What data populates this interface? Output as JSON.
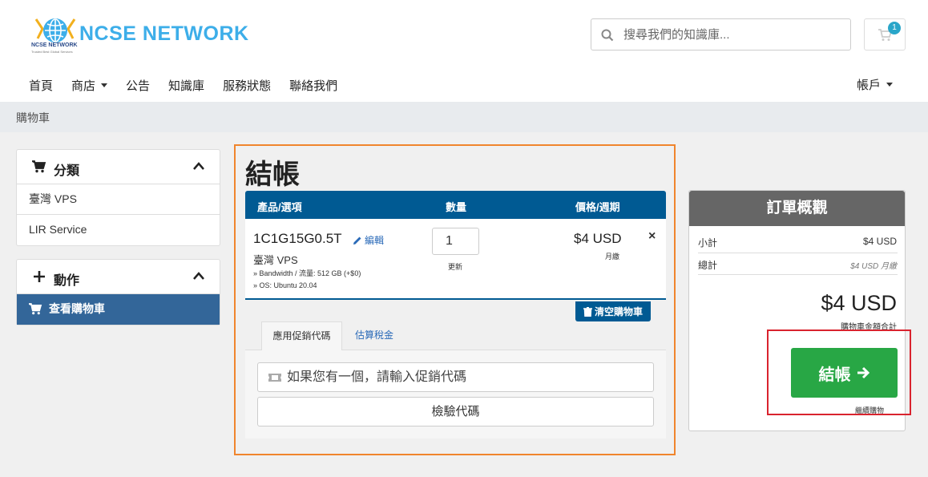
{
  "brand": {
    "name": "NCSE NETWORK",
    "sub": "NCSE NETWORK",
    "tagline": "Trusted Best Global Services"
  },
  "search": {
    "placeholder": "搜尋我們的知識庫..."
  },
  "cart": {
    "count": "1"
  },
  "nav": {
    "items": [
      "首頁",
      "商店",
      "公告",
      "知識庫",
      "服務狀態",
      "聯絡我們"
    ],
    "account": "帳戶"
  },
  "breadcrumb": "購物車",
  "sidebar": {
    "categories_title": "分類",
    "categories": [
      "臺灣 VPS",
      "LIR Service"
    ],
    "actions_title": "動作",
    "actions": [
      "查看購物車"
    ]
  },
  "checkout": {
    "title": "結帳",
    "columns": {
      "product": "產品/選項",
      "qty": "數量",
      "price": "價格/週期"
    },
    "item": {
      "name": "1C1G15G0.5T",
      "edit": "編輯",
      "group": "臺灣 VPS",
      "option1": "» Bandwidth / 流量: 512 GB (+$0)",
      "option2": "» OS: Ubuntu 20.04",
      "qty": "1",
      "update": "更新",
      "price": "$4 USD",
      "cycle": "月繳",
      "remove": "×"
    },
    "empty_cart": "清空購物車",
    "tabs": [
      "應用促銷代碼",
      "估算稅金"
    ],
    "promo_placeholder": "如果您有一個，請輸入促銷代碼",
    "validate": "檢驗代碼"
  },
  "summary": {
    "title": "訂單概觀",
    "subtotal_label": "小計",
    "subtotal": "$4 USD",
    "total_label": "總計",
    "total_small": "$4 USD 月繳",
    "total": "$4 USD",
    "total_caption": "購物車金額合計",
    "checkout": "結帳",
    "continue": "繼續購物"
  },
  "colors": {
    "brand": "#3daee9",
    "primary": "#005a93",
    "sidebar_active": "#336699",
    "success": "#28a745",
    "highlight_main": "#f0852d",
    "highlight_checkout": "#d9232e"
  }
}
